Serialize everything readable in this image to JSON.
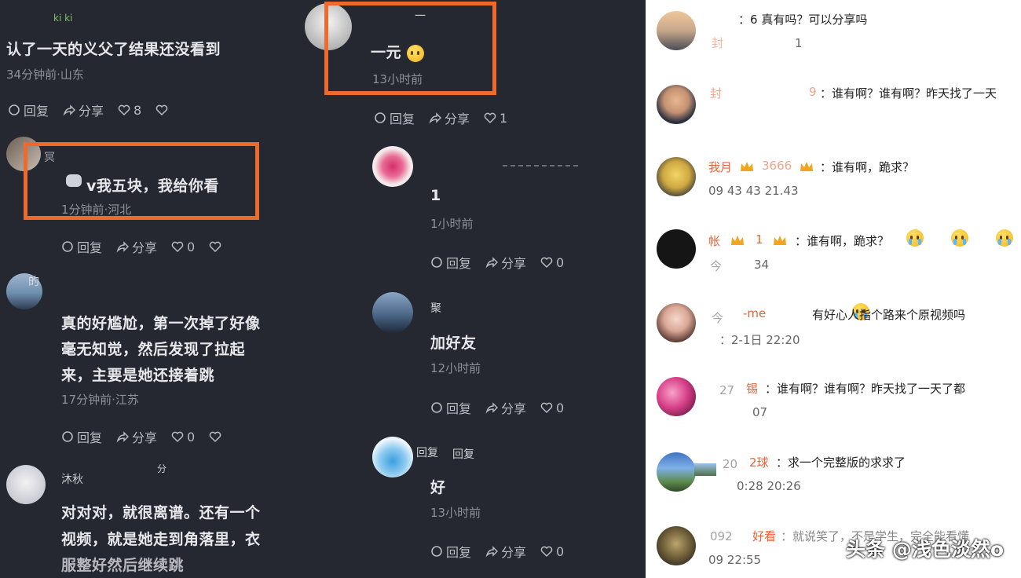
{
  "left": {
    "c1": {
      "name": "ki ki",
      "text": "认了一天的义父了结果还没看到",
      "meta": "34分钟前·山东",
      "reply": "回复",
      "share": "分享",
      "likes": "8"
    },
    "c2": {
      "name": "冥",
      "text": "v我五块，我给你看",
      "meta": "1分钟前·河北",
      "reply": "回复",
      "share": "分享",
      "likes": "0"
    },
    "c3": {
      "name": "的",
      "text_lines": [
        "真的好尴尬，第一次掉了好像",
        "毫无知觉，然后发现了拉起",
        "来，主要是她还接着跳"
      ],
      "meta": "17分钟前·江苏",
      "reply": "回复",
      "share": "分享",
      "likes": "0"
    },
    "c4": {
      "name": "沐秋",
      "extra": "分",
      "text_lines": [
        "对对对，就很离谱。还有一个",
        "视频，就是她走到角落里，衣",
        "服整好然后继续跳"
      ]
    }
  },
  "middle": {
    "c1": {
      "name": "一",
      "text": "一元",
      "meta": "13小时前",
      "reply": "回复",
      "share": "分享",
      "likes": "1"
    },
    "c2": {
      "text": "1",
      "meta": "1小时前",
      "reply": "回复",
      "share": "分享",
      "likes": "0"
    },
    "c3": {
      "name": "聚",
      "text": "加好友",
      "meta": "12小时前",
      "reply": "回复",
      "share": "分享",
      "likes": "0"
    },
    "c4": {
      "name": "回复",
      "name2": "回复",
      "text": "好",
      "meta": "13小时前",
      "reply": "回复",
      "share": "分享",
      "likes": "0"
    }
  },
  "right": [
    {
      "name": "：6",
      "text": "真有吗？可以分享吗",
      "meta": "1",
      "name_sub": "封"
    },
    {
      "name": "封",
      "mid": "9",
      "text": "：谁有啊？谁有啊？昨天找了一天",
      "meta": ""
    },
    {
      "name": "我月",
      "mid": "3666",
      "text": "：谁有啊，跪求？",
      "meta": "09 43 43 21.43"
    },
    {
      "name": "帐",
      "mid": "1",
      "text": "：谁有啊，跪求？",
      "meta": "34",
      "sub": "今"
    },
    {
      "name": "-me",
      "text": "有好心人指个路来个原视频吗",
      "meta": "：2-1日 22:20",
      "sub": "今"
    },
    {
      "name": "锡",
      "pre": "27",
      "text": "：谁有啊？谁有啊？昨天找了一天了都",
      "meta": "07"
    },
    {
      "name": "2球",
      "pre": "20",
      "text": "：求一个完整版的求求了",
      "meta": "0:28 20:26"
    },
    {
      "name": "好看",
      "pre": "092",
      "text": "：就说笑了，不是学生，完全能看懂",
      "meta": "09 22:55"
    }
  ],
  "watermark": "头条 @浅色淡然o"
}
